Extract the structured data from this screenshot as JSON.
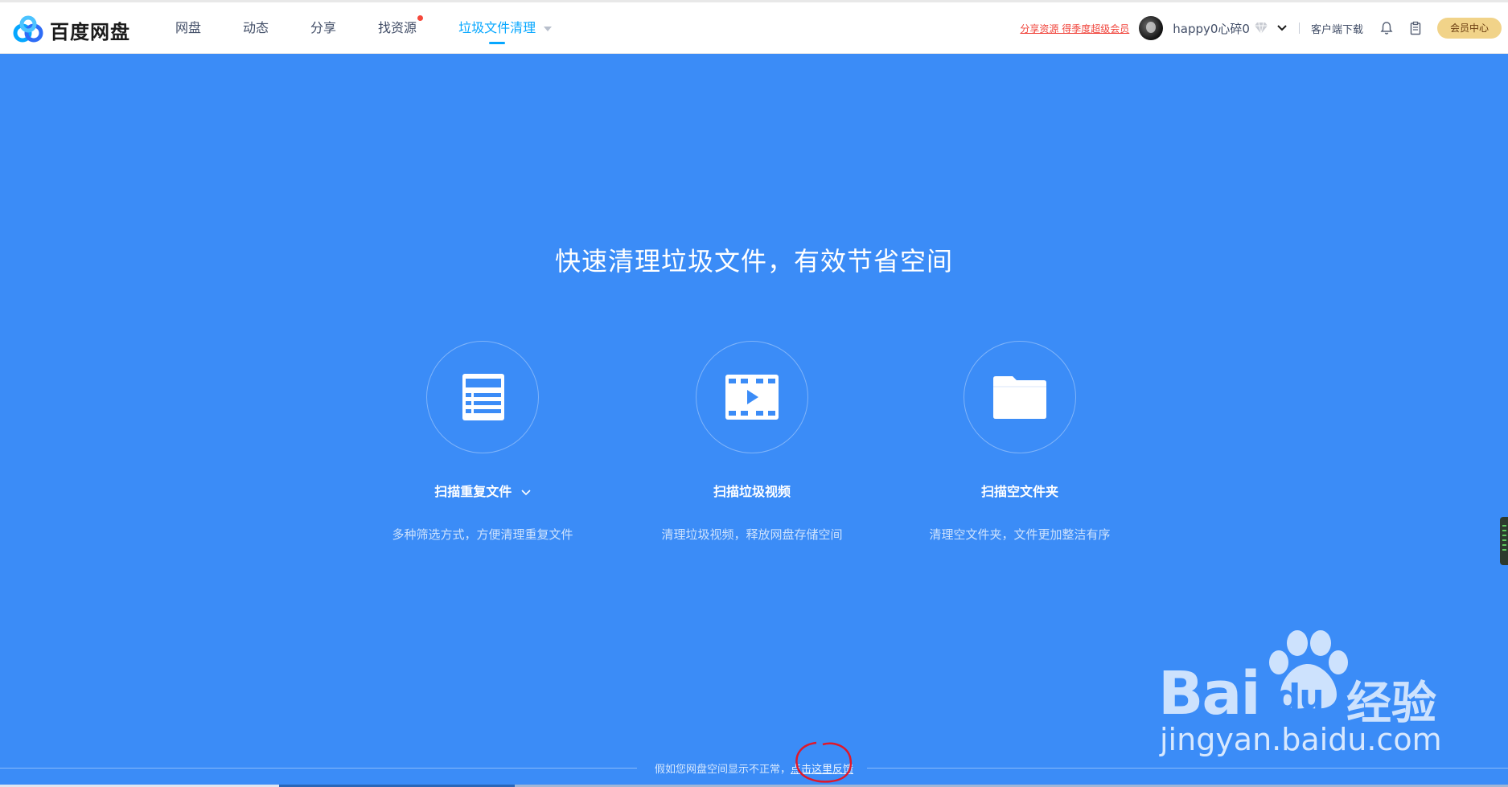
{
  "app": {
    "name": "百度网盘"
  },
  "nav": {
    "items": [
      {
        "label": "网盘"
      },
      {
        "label": "动态"
      },
      {
        "label": "分享"
      },
      {
        "label": "找资源",
        "badge": true
      },
      {
        "label": "垃圾文件清理",
        "active": true
      }
    ]
  },
  "header": {
    "promo": "分享资源 得季度超级会员",
    "username": "happy0心碎0",
    "client_download": "客户端下载",
    "member_center": "会员中心"
  },
  "main": {
    "headline": "快速清理垃圾文件，有效节省空间",
    "cards": [
      {
        "title": "扫描重复文件",
        "desc": "多种筛选方式，方便清理重复文件",
        "icon": "list-doc-icon",
        "has_dropdown": true
      },
      {
        "title": "扫描垃圾视频",
        "desc": "清理垃圾视频，释放网盘存储空间",
        "icon": "video-film-icon",
        "has_dropdown": false
      },
      {
        "title": "扫描空文件夹",
        "desc": "清理空文件夹，文件更加整洁有序",
        "icon": "folder-icon",
        "has_dropdown": false
      }
    ]
  },
  "footer": {
    "text_before": "假如您网盘空间显示不正常，",
    "link_text": "点击这里反馈"
  },
  "watermark": {
    "brand": "Bai",
    "brand_du": "du",
    "cn": "经验",
    "url": "jingyan.baidu.com"
  },
  "colors": {
    "background": "#3b8cf7",
    "active_nav": "#06a7ff",
    "promo": "#f0443b",
    "member_btn": "#f1d389"
  }
}
